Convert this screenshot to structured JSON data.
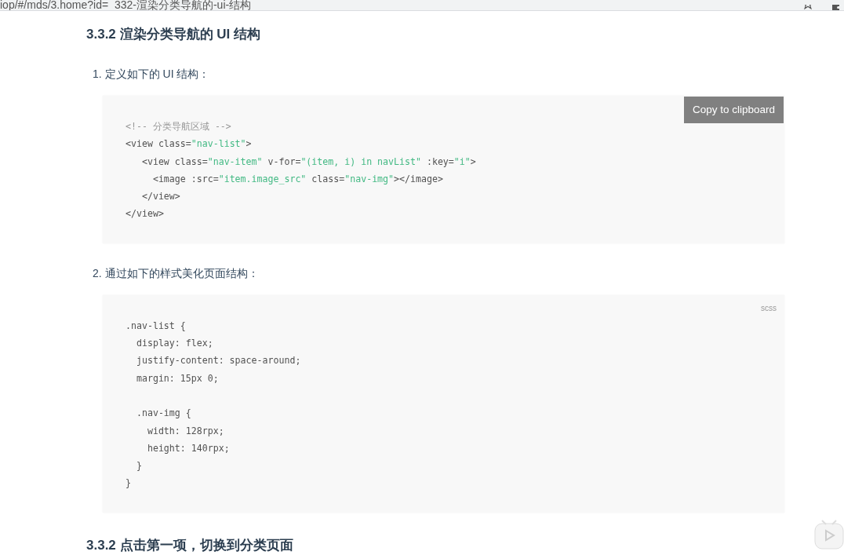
{
  "address_bar": {
    "url": "iop/#/mds/3.home?id=_332-渲染分类导航的-ui-结构"
  },
  "content": [
    {
      "kind": "heading",
      "text": "3.3.2 渲染分类导航的 UI 结构"
    },
    {
      "kind": "step",
      "number": "1.",
      "text": "定义如下的 UI 结构："
    },
    {
      "kind": "code",
      "copy_button": "Copy to clipboard",
      "lines": [
        [
          {
            "kind": "comment",
            "t": "<!-- 分类导航区域 -->"
          }
        ],
        [
          {
            "kind": "plain",
            "t": "<view class="
          },
          {
            "kind": "string",
            "t": "\"nav-list\""
          },
          {
            "kind": "plain",
            "t": ">"
          }
        ],
        [
          {
            "kind": "plain",
            "t": "   <view class="
          },
          {
            "kind": "string",
            "t": "\"nav-item\""
          },
          {
            "kind": "plain",
            "t": " v-for="
          },
          {
            "kind": "string",
            "t": "\"(item, i) in navList\""
          },
          {
            "kind": "plain",
            "t": " :key="
          },
          {
            "kind": "string",
            "t": "\"i\""
          },
          {
            "kind": "plain",
            "t": ">"
          }
        ],
        [
          {
            "kind": "plain",
            "t": "     <image :src="
          },
          {
            "kind": "string",
            "t": "\"item.image_src\""
          },
          {
            "kind": "plain",
            "t": " class="
          },
          {
            "kind": "string",
            "t": "\"nav-img\""
          },
          {
            "kind": "plain",
            "t": "></image>"
          }
        ],
        [
          {
            "kind": "plain",
            "t": "   </view>"
          }
        ],
        [
          {
            "kind": "plain",
            "t": "</view>"
          }
        ]
      ]
    },
    {
      "kind": "step",
      "number": "2.",
      "text": "通过如下的样式美化页面结构："
    },
    {
      "kind": "code",
      "language": "scss",
      "lines": [
        [
          {
            "kind": "plain",
            "t": ".nav-list {"
          }
        ],
        [
          {
            "kind": "plain",
            "t": "  display: flex;"
          }
        ],
        [
          {
            "kind": "plain",
            "t": "  justify-content: space-around;"
          }
        ],
        [
          {
            "kind": "plain",
            "t": "  margin: 15px 0;"
          }
        ],
        [
          {
            "kind": "plain",
            "t": "  .nav-img {",
            "gap_before": true
          }
        ],
        [
          {
            "kind": "plain",
            "t": "    width: 128rpx;"
          }
        ],
        [
          {
            "kind": "plain",
            "t": "    height: 140rpx;"
          }
        ],
        [
          {
            "kind": "plain",
            "t": "  }"
          }
        ],
        [
          {
            "kind": "plain",
            "t": "}"
          }
        ]
      ]
    },
    {
      "kind": "heading",
      "text": "3.3.2 点击第一项，切换到分类页面"
    }
  ]
}
